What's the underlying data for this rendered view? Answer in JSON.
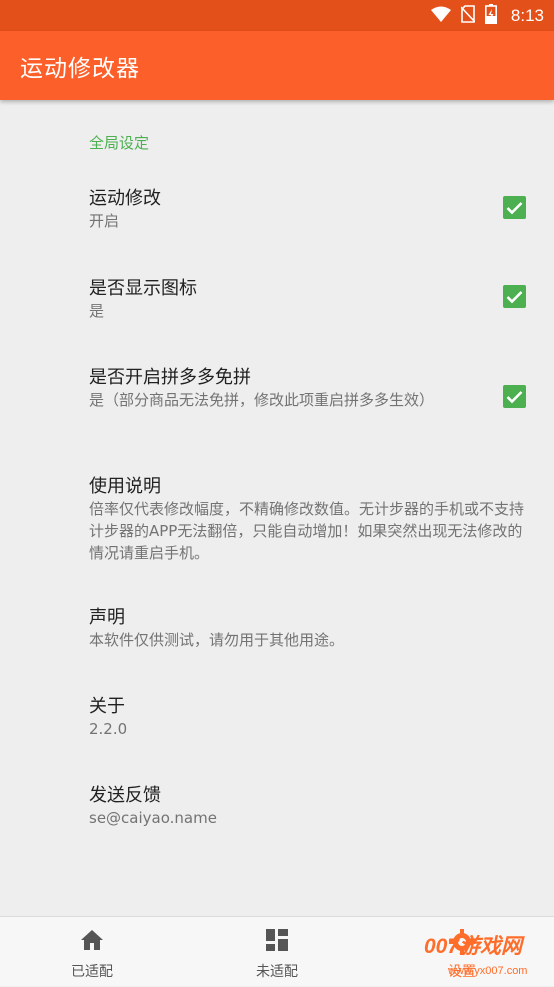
{
  "status_bar": {
    "time": "8:13",
    "icons": [
      "wifi-icon",
      "no-sim-icon",
      "battery-charging-icon"
    ]
  },
  "app_bar": {
    "title": "运动修改器"
  },
  "settings": {
    "category": "全局设定",
    "items": [
      {
        "title": "运动修改",
        "summary": "开启",
        "checked": true
      },
      {
        "title": "是否显示图标",
        "summary": "是",
        "checked": true
      },
      {
        "title": "是否开启拼多多免拼",
        "summary": "是（部分商品无法免拼，修改此项重启拼多多生效）",
        "checked": true
      },
      {
        "title": "使用说明",
        "summary": "倍率仅代表修改幅度，不精确修改数值。无计步器的手机或不支持计步器的APP无法翻倍，只能自动增加！如果突然出现无法修改的情况请重启手机。"
      },
      {
        "title": "声明",
        "summary": "本软件仅供测试，请勿用于其他用途。"
      },
      {
        "title": "关于",
        "summary": "2.2.0"
      },
      {
        "title": "发送反馈",
        "summary": "se@caiyao.name"
      }
    ]
  },
  "bottom_nav": {
    "items": [
      {
        "label": "已适配",
        "icon": "home-icon"
      },
      {
        "label": "未适配",
        "icon": "dashboard-icon"
      },
      {
        "label": "设置",
        "icon": "settings-icon"
      }
    ]
  },
  "watermark": {
    "text": "007游戏网",
    "url": "www.yx007.com"
  },
  "colors": {
    "status_bar": "#e4501a",
    "app_bar": "#fd5f2a",
    "accent": "#4caf50",
    "background": "#eeeeee"
  }
}
